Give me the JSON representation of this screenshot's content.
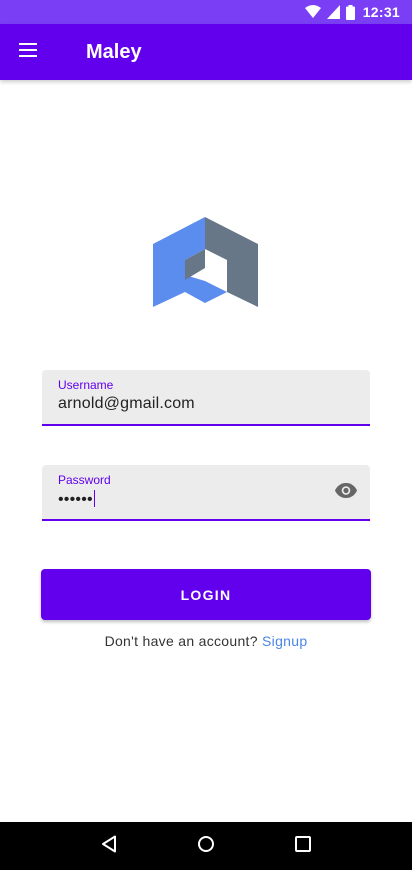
{
  "status_bar": {
    "time": "12:31",
    "icons": [
      "wifi-icon",
      "signal-icon",
      "battery-icon"
    ]
  },
  "app_bar": {
    "title": "Maley",
    "menu_icon": "menu-icon"
  },
  "logo": {
    "colors": {
      "blue": "#5b8def",
      "slate": "#677787"
    }
  },
  "form": {
    "username": {
      "label": "Username",
      "value": "arnold@gmail.com"
    },
    "password": {
      "label": "Password",
      "value": "••••••",
      "toggle_icon": "eye-icon"
    },
    "login_label": "LOGIN",
    "signup_prompt": "Don't have an account?",
    "signup_link": "Signup"
  },
  "nav_bar": {
    "icons": [
      "back-icon",
      "home-icon",
      "recents-icon"
    ]
  },
  "colors": {
    "primary": "#6200ee",
    "status_bar": "#7a3ff5",
    "link": "#4a86e8",
    "field_bg": "#ececec"
  }
}
